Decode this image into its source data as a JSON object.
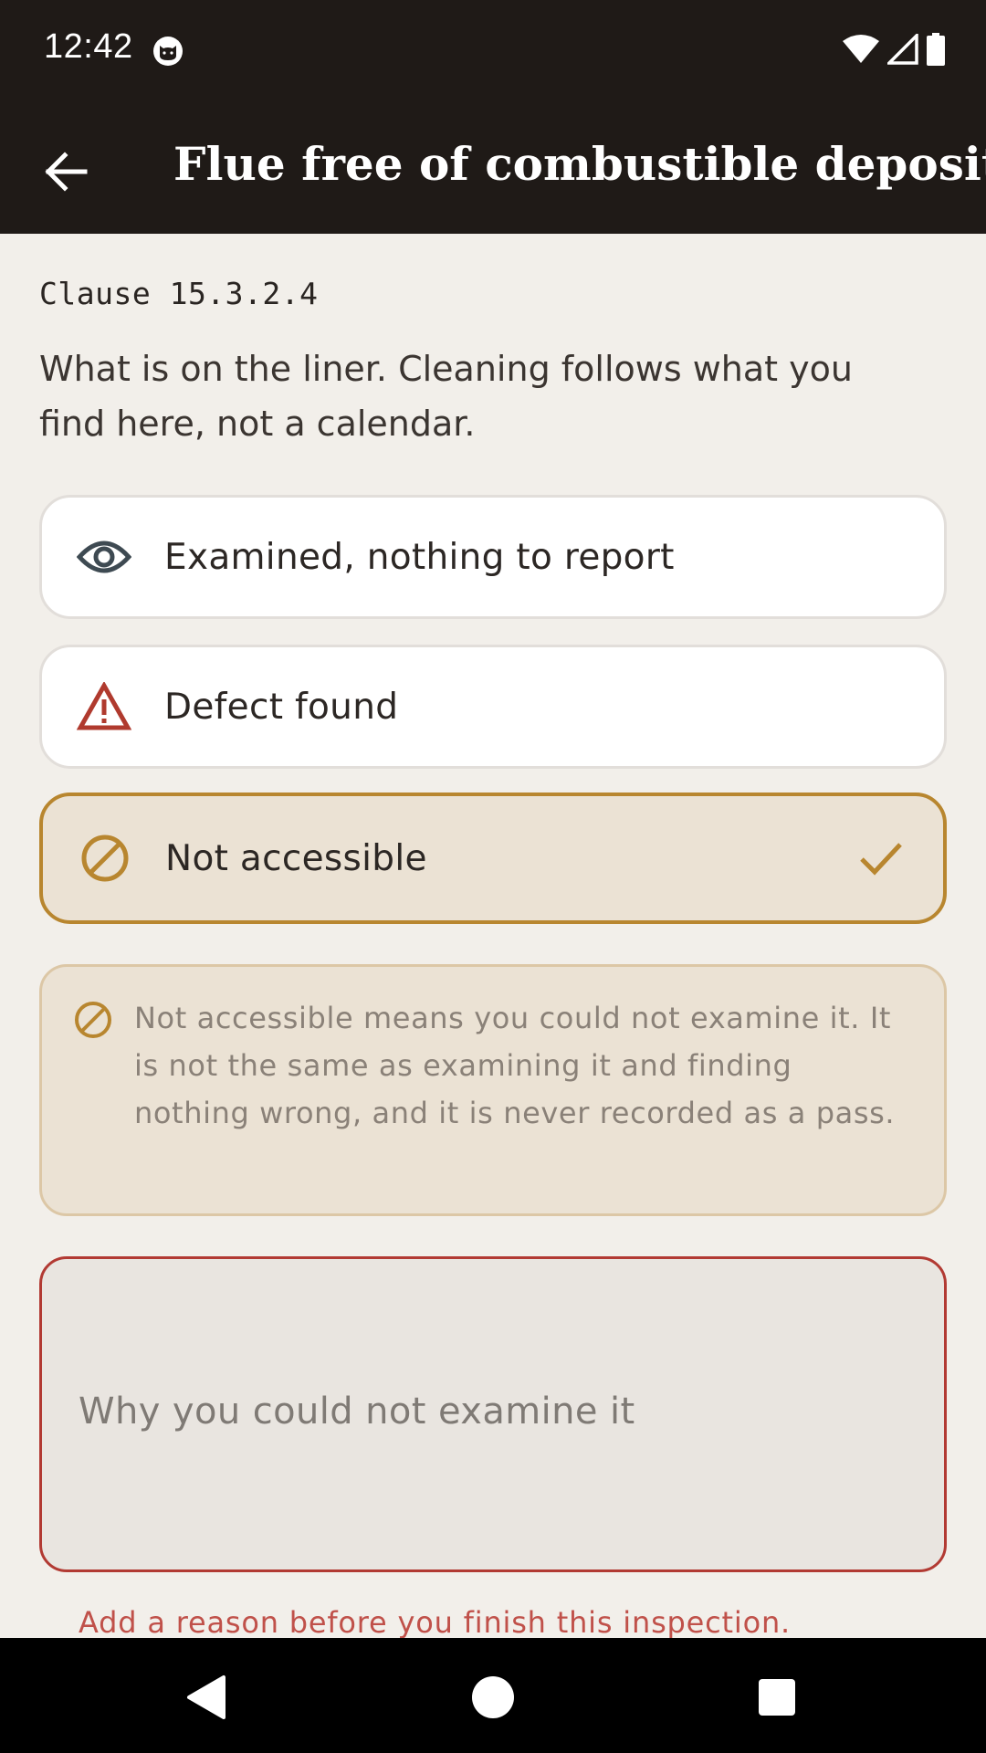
{
  "status_bar": {
    "time": "12:42",
    "icons": [
      "cat-notification-icon",
      "wifi-icon",
      "signal-icon",
      "battery-icon"
    ]
  },
  "app_bar": {
    "back_icon": "arrow-left-icon",
    "title": "Flue free of combustible deposits"
  },
  "content": {
    "clause": "Clause 15.3.2.4",
    "description": "What is on the liner. Cleaning follows what you find here, not a calendar.",
    "options": [
      {
        "label": "Examined, nothing to report",
        "icon": "eye-icon",
        "selected": false
      },
      {
        "label": "Defect found",
        "icon": "warning-icon",
        "selected": false
      },
      {
        "label": "Not accessible",
        "icon": "prohibited-icon",
        "selected": true
      }
    ],
    "info": {
      "icon": "prohibited-icon",
      "text": "Not accessible means you could not examine it. It is not the same as examining it and finding nothing wrong, and it is never recorded as a pass."
    },
    "reason_field": {
      "placeholder": "Why you could not examine it",
      "value": ""
    },
    "error": "Add a reason before you finish this inspection."
  },
  "colors": {
    "app_bar": "#1f1a17",
    "background": "#f2efea",
    "accent": "#b8862f",
    "error": "#b23a33",
    "eye_icon": "#3e4a52",
    "warning_icon": "#b03a2e"
  },
  "nav_bar": {
    "icons": [
      "back-triangle-icon",
      "home-circle-icon",
      "recents-square-icon"
    ]
  }
}
